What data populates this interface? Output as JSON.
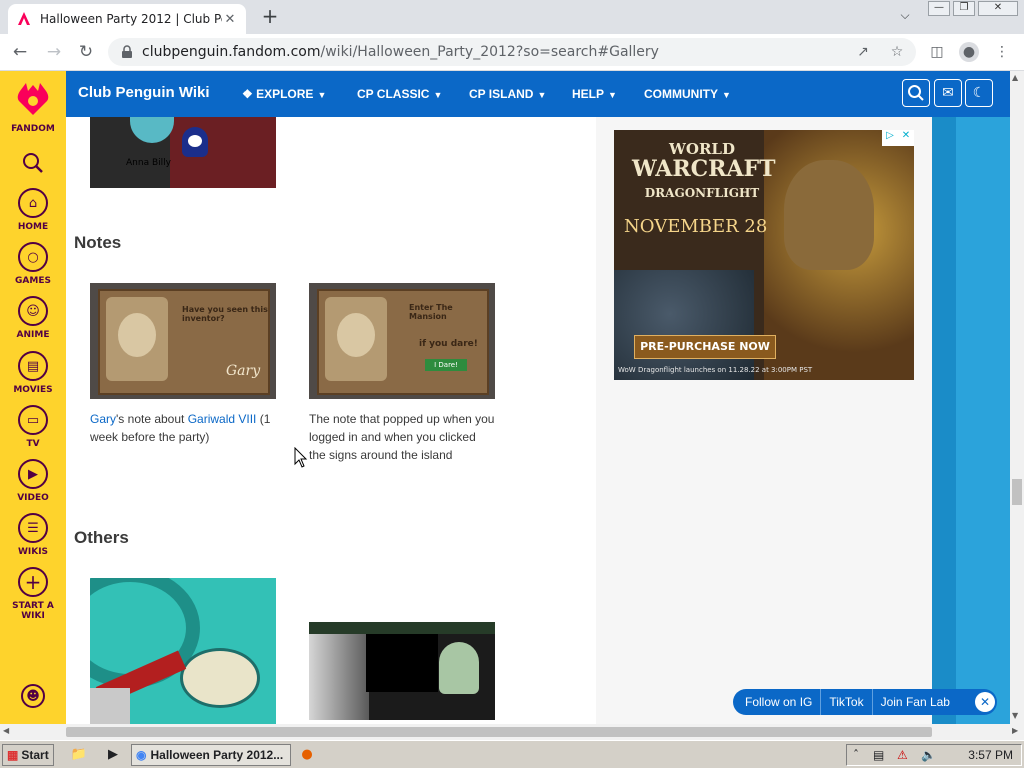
{
  "browser": {
    "tab_title": "Halloween Party 2012 | Club Pengui",
    "tab_close": "✕",
    "new_tab": "+",
    "url_host": "clubpenguin.fandom.com",
    "url_path": "/wiki/Halloween_Party_2012?so=search#Gallery"
  },
  "rail": {
    "brand": "FANDOM",
    "items": [
      {
        "label": "HOME"
      },
      {
        "label": "GAMES"
      },
      {
        "label": "ANIME"
      },
      {
        "label": "MOVIES"
      },
      {
        "label": "TV"
      },
      {
        "label": "VIDEO"
      },
      {
        "label": "WIKIS"
      },
      {
        "label": "START A WIKI"
      }
    ]
  },
  "wiki": {
    "name": "Club Penguin Wiki",
    "nav": [
      {
        "label": "EXPLORE"
      },
      {
        "label": "CP CLASSIC"
      },
      {
        "label": "CP ISLAND"
      },
      {
        "label": "HELP"
      },
      {
        "label": "COMMUNITY"
      }
    ]
  },
  "content": {
    "top_thumb_text": "Anna Billy",
    "sections": {
      "notes": "Notes",
      "others": "Others"
    },
    "notes": [
      {
        "caption_link1": "Gary",
        "caption_mid": "'s note about ",
        "caption_link2": "Gariwald VIII",
        "caption_end": " (1 week before the party)",
        "img_heading": "Have you seen this inventor?",
        "img_sign": "Gary"
      },
      {
        "caption": "The note that popped up when you logged in and when you clicked the signs around the island",
        "img_heading": "Enter The Mansion",
        "img_line": "if you dare!",
        "img_button": "I Dare!"
      }
    ]
  },
  "ad": {
    "line1": "WORLD",
    "line2": "WARCRAFT",
    "line3": "DRAGONFLIGHT",
    "date": "NOVEMBER 28",
    "cta": "PRE-PURCHASE NOW",
    "footer": "WoW Dragonflight launches on 11.28.22 at 3:00PM PST"
  },
  "social": {
    "items": [
      "Follow on IG",
      "TikTok",
      "Join Fan Lab"
    ]
  },
  "taskbar": {
    "start": "Start",
    "task": "Halloween Party 2012...",
    "time": "3:57 PM"
  }
}
